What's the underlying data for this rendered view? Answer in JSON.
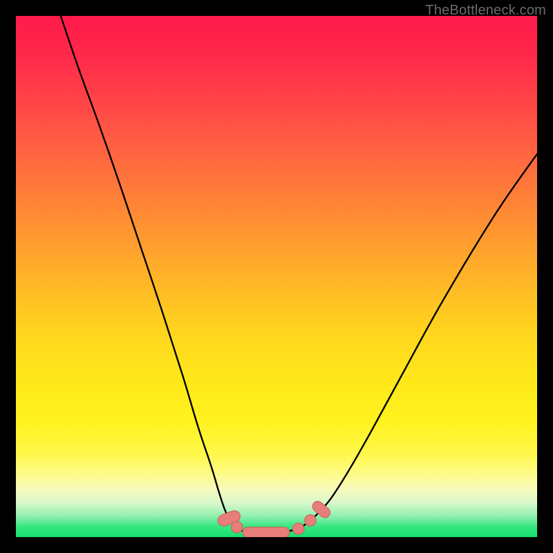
{
  "watermark": {
    "text": "TheBottleneck.com"
  },
  "colors": {
    "page_bg": "#000000",
    "gradient": [
      "#ff1a4b",
      "#ff2a4a",
      "#ff4a46",
      "#ff6a3f",
      "#ff8a34",
      "#ffb328",
      "#ffd31e",
      "#ffe81a",
      "#fff21f",
      "#fff84a",
      "#fdfb8a",
      "#f6fac0",
      "#d7f7c8",
      "#90efb0",
      "#36e77f",
      "#16e070"
    ],
    "curve": "#000000",
    "marker_fill": "#e77e7a",
    "marker_stroke": "#c95f5a"
  },
  "chart_data": {
    "type": "line",
    "title": "",
    "xlabel": "",
    "ylabel": "",
    "xlim": [
      0,
      100
    ],
    "ylim": [
      0,
      100
    ],
    "grid": false,
    "legend": false,
    "annotations": [],
    "series": [
      {
        "name": "curve",
        "x": [
          8.6,
          12,
          16,
          20,
          24,
          28,
          32,
          35,
          37.5,
          39,
          40.2,
          41.5,
          43,
          45,
          48,
          51,
          54,
          56,
          58,
          60.5,
          64,
          68,
          74,
          82,
          92,
          100
        ],
        "y": [
          100,
          90,
          79,
          67.5,
          55.5,
          43.5,
          31,
          21,
          13.5,
          8.5,
          5,
          2.7,
          1.4,
          0.9,
          0.85,
          0.95,
          1.6,
          2.8,
          4.6,
          7.5,
          13,
          20,
          31,
          45.5,
          62,
          73.5
        ]
      }
    ],
    "markers": [
      {
        "shape": "capsule",
        "cx": 40.9,
        "cy": 3.6,
        "w": 2.2,
        "h": 4.4,
        "angle": 70
      },
      {
        "shape": "circle",
        "cx": 42.4,
        "cy": 1.9,
        "r": 1.1
      },
      {
        "shape": "capsule",
        "cx": 48.0,
        "cy": 0.9,
        "w": 9.0,
        "h": 2.0,
        "angle": 0
      },
      {
        "shape": "circle",
        "cx": 54.2,
        "cy": 1.6,
        "r": 1.1
      },
      {
        "shape": "circle",
        "cx": 56.5,
        "cy": 3.2,
        "r": 1.1
      },
      {
        "shape": "capsule",
        "cx": 58.6,
        "cy": 5.3,
        "w": 2.0,
        "h": 3.8,
        "angle": -50
      }
    ]
  }
}
